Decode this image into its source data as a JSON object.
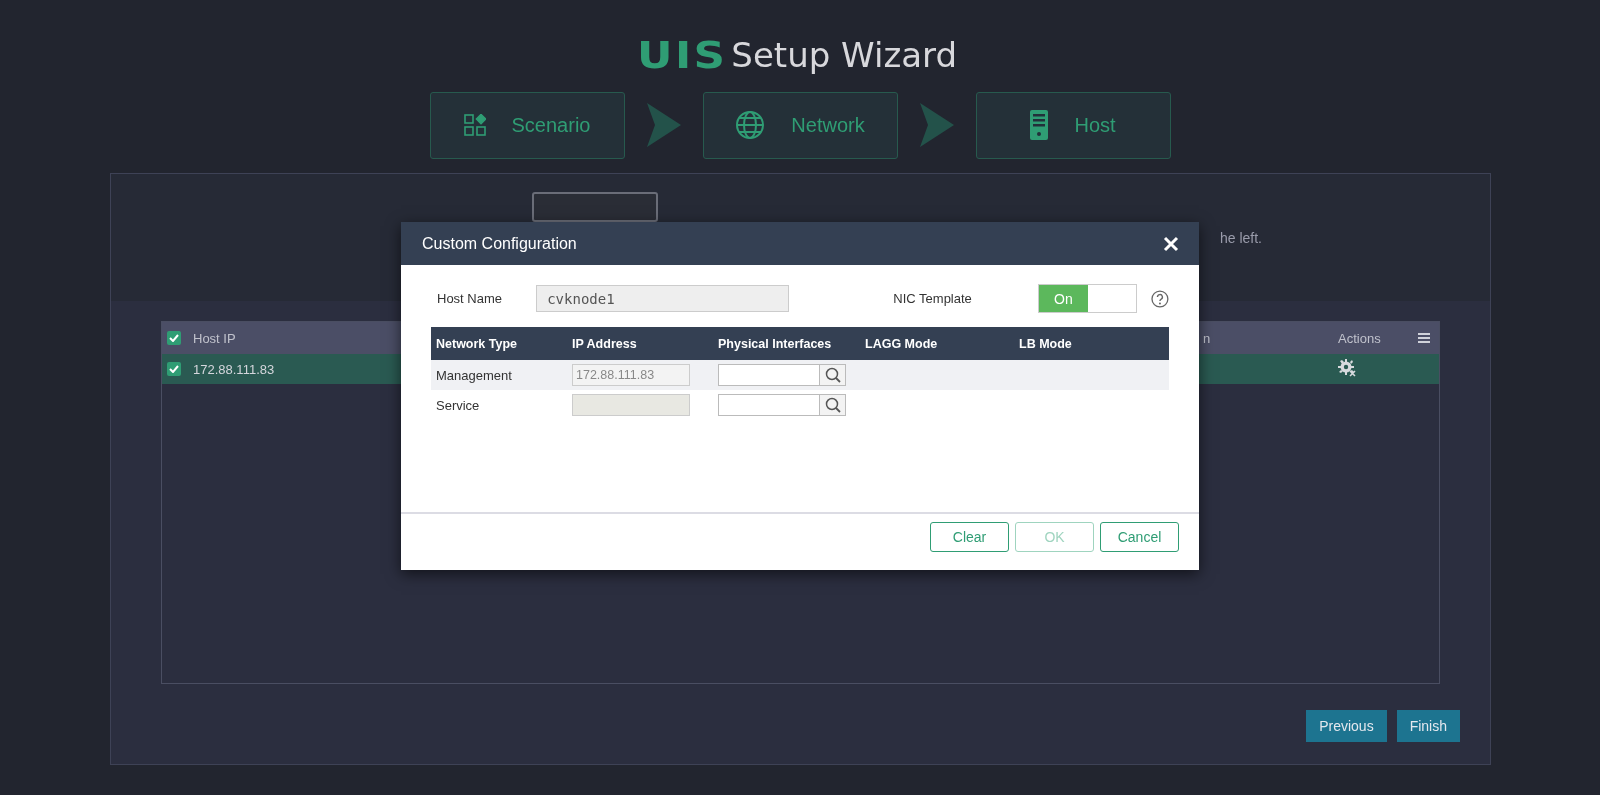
{
  "header": {
    "logo": "UIS",
    "title": "Setup Wizard"
  },
  "steps": [
    {
      "label": "Scenario",
      "kind": "grid"
    },
    {
      "label": "Network",
      "kind": "globe"
    },
    {
      "label": "Host",
      "kind": "server"
    }
  ],
  "panel": {
    "hint_fragment": "he left.",
    "table": {
      "header_checked": true,
      "columns": [
        {
          "label": "Host IP"
        },
        {
          "label": "n"
        },
        {
          "label": "Actions"
        }
      ],
      "rows": [
        {
          "checked": true,
          "selected": true,
          "host_ip": "172.88.111.83"
        }
      ]
    },
    "buttons": [
      "Previous",
      "Finish"
    ]
  },
  "dialog": {
    "title": "Custom Configuration",
    "host_name_label": "Host Name",
    "host_name": "cvknode1",
    "nic_template_label": "NIC Template",
    "nic_template": {
      "label": "On",
      "on": true
    },
    "table": {
      "columns": [
        "Network Type",
        "IP Address",
        "Physical Interfaces",
        "LAGG Mode",
        "LB Mode"
      ],
      "rows": [
        {
          "network_type": "Management",
          "ip_address": "172.88.111.83"
        },
        {
          "network_type": "Service"
        }
      ]
    },
    "buttons": [
      {
        "label": "Clear",
        "disabled": false
      },
      {
        "label": "OK",
        "disabled": true
      },
      {
        "label": "Cancel",
        "disabled": false
      }
    ]
  }
}
